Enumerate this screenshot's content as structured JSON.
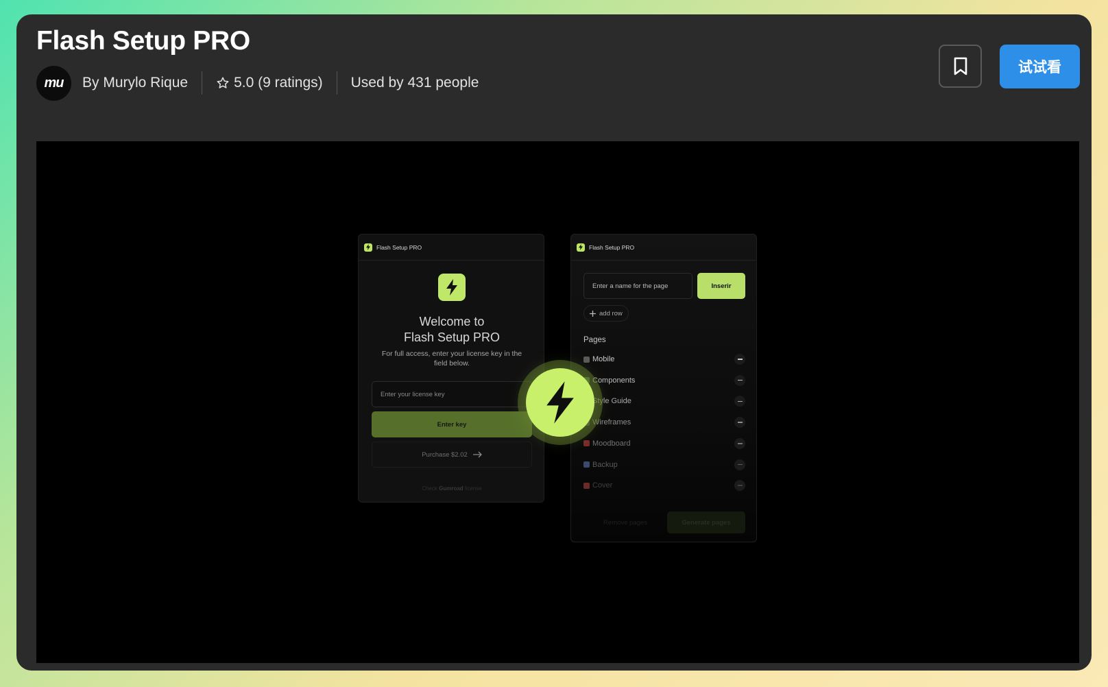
{
  "header": {
    "title": "Flash Setup PRO",
    "avatar_text": "mu",
    "author": "By Murylo Rique",
    "rating": "5.0 (9 ratings)",
    "used_by": "Used by 431 people",
    "try_button": "试试看"
  },
  "preview": {
    "left_panel": {
      "header_title": "Flash Setup PRO",
      "welcome_line1": "Welcome to",
      "welcome_line2": "Flash Setup PRO",
      "subtitle": "For full access, enter your license key in the field below.",
      "license_placeholder": "Enter your license key",
      "enter_key_button": "Enter key",
      "purchase_button": "Purchase $2.02",
      "check_prefix": "Check",
      "check_brand": "Gumroad",
      "check_suffix": "license"
    },
    "right_panel": {
      "header_title": "Flash Setup PRO",
      "page_name_placeholder": "Enter a name for the page",
      "insert_button": "Inserir",
      "add_row": "add row",
      "pages_title": "Pages",
      "pages": [
        {
          "label": "Mobile",
          "emoji_color": "#5a5a5a",
          "text_color": "#c8c8c8"
        },
        {
          "label": "Components",
          "emoji_color": "#4d6a3a",
          "text_color": "#bdbdbd"
        },
        {
          "label": "Style Guide",
          "emoji_color": "#6a5a3a",
          "text_color": "#a9a9a9"
        },
        {
          "label": "Wireframes",
          "emoji_color": "#3a4a3a",
          "text_color": "#8e8e8e"
        },
        {
          "label": "Moodboard",
          "emoji_color": "#7a2a2a",
          "text_color": "#737373"
        },
        {
          "label": "Backup",
          "emoji_color": "#3a4a6a",
          "text_color": "#5a5a5a"
        },
        {
          "label": "Cover",
          "emoji_color": "#6a2a2a",
          "text_color": "#3e3e3e"
        }
      ],
      "remove_button": "Remove pages",
      "generate_button": "Generate pages"
    }
  },
  "colors": {
    "accent_green": "#c0e868",
    "try_button_blue": "#2d8fe8",
    "card_bg": "#2b2b2b"
  }
}
